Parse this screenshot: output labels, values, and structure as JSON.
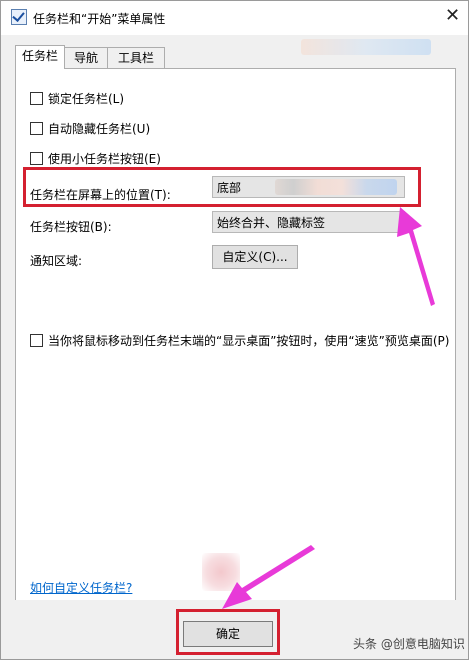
{
  "window": {
    "title": "任务栏和“开始”菜单属性",
    "close_glyph": "✕"
  },
  "tabs": [
    {
      "label": "任务栏",
      "active": true
    },
    {
      "label": "导航",
      "active": false
    },
    {
      "label": "工具栏",
      "active": false
    }
  ],
  "options": {
    "lock_taskbar": {
      "label": "锁定任务栏(L)",
      "checked": false
    },
    "auto_hide": {
      "label": "自动隐藏任务栏(U)",
      "checked": false
    },
    "small_buttons": {
      "label": "使用小任务栏按钮(E)",
      "checked": false
    },
    "peek": {
      "label": "当你将鼠标移动到任务栏末端的“显示桌面”按钮时，使用“速览”预览桌面(P)",
      "checked": false
    }
  },
  "position_row": {
    "label": "任务栏在屏幕上的位置(T):",
    "value": "底部"
  },
  "buttons_row": {
    "label": "任务栏按钮(B):",
    "value": "始终合并、隐藏标签"
  },
  "notify_row": {
    "label": "通知区域:",
    "button_label": "自定义(C)..."
  },
  "help_link": "如何自定义任务栏?",
  "footer": {
    "ok_label": "确定"
  },
  "watermark": "头条 @创意电脑知识",
  "colors": {
    "highlight": "#d42030",
    "arrow": "#e83ad8",
    "link": "#0066cc"
  }
}
